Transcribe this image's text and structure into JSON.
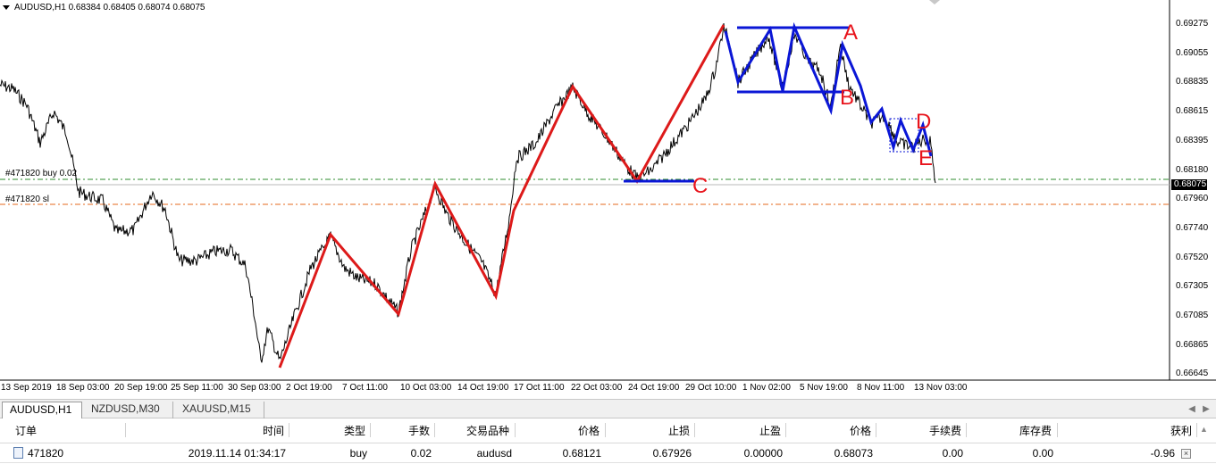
{
  "window": {
    "symbol_header": "AUDUSD,H1  0.68384 0.68405 0.68074 0.68075"
  },
  "chart": {
    "order_lines": {
      "buy_label": "#471820 buy 0.02",
      "sl_label": "#471820 sl"
    },
    "price_axis": [
      "0.69275",
      "0.69055",
      "0.68835",
      "0.68615",
      "0.68395",
      "0.68180",
      "0.67960",
      "0.67740",
      "0.67520",
      "0.67305",
      "0.67085",
      "0.66865",
      "0.66645"
    ],
    "current_price": "0.68075",
    "time_axis": [
      "13 Sep 2019",
      "18 Sep 03:00",
      "20 Sep 19:00",
      "25 Sep 11:00",
      "30 Sep 03:00",
      "2 Oct 19:00",
      "7 Oct 11:00",
      "10 Oct 03:00",
      "14 Oct 19:00",
      "17 Oct 11:00",
      "22 Oct 03:00",
      "24 Oct 19:00",
      "29 Oct 10:00",
      "1 Nov 02:00",
      "5 Nov 19:00",
      "8 Nov 11:00",
      "13 Nov 03:00"
    ],
    "pattern_letters": [
      "A",
      "B",
      "C",
      "D",
      "E"
    ],
    "colors": {
      "red_zigzag": "#dd1a1a",
      "blue_pattern": "#0a16d6",
      "buy_line": "#2e8b2e",
      "sl_line": "#e46a1e",
      "letters": "#e8141c"
    }
  },
  "tabs": [
    {
      "label": "AUDUSD,H1",
      "active": true
    },
    {
      "label": "NZDUSD,M30",
      "active": false
    },
    {
      "label": "XAUUSD,M15",
      "active": false
    }
  ],
  "terminal": {
    "headers": [
      "订单",
      "时间",
      "类型",
      "手数",
      "交易品种",
      "价格",
      "止损",
      "止盈",
      "价格",
      "手续费",
      "库存费",
      "获利"
    ],
    "row": {
      "order": "471820",
      "time": "2019.11.14 01:34:17",
      "type": "buy",
      "lots": "0.02",
      "symbol": "audusd",
      "open_price": "0.68121",
      "sl": "0.67926",
      "tp": "0.00000",
      "price": "0.68073",
      "commission": "0.00",
      "swap": "0.00",
      "profit": "-0.96"
    }
  }
}
